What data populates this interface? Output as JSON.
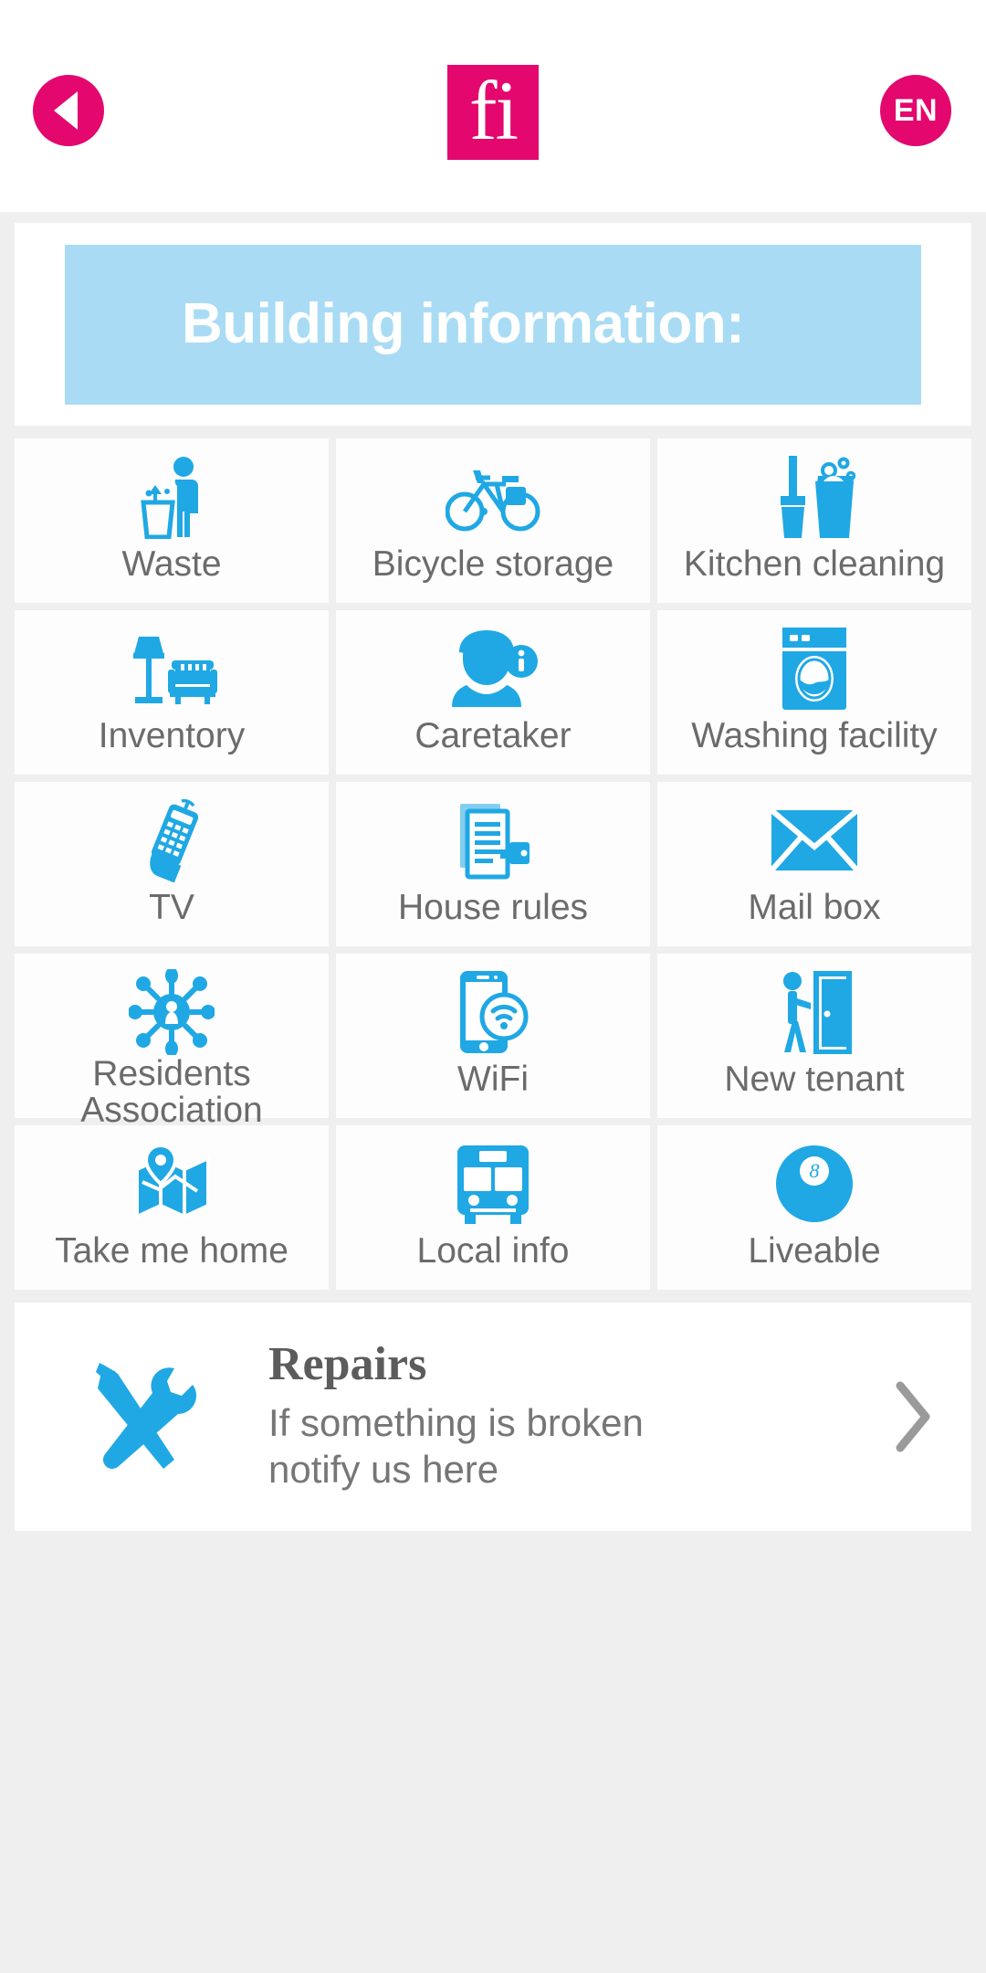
{
  "header": {
    "back_label": "back-arrow",
    "logo_text": "fi",
    "language": "EN"
  },
  "title": {
    "text": "Building information:"
  },
  "grid": {
    "tiles": [
      {
        "label": "Waste",
        "icon": "waste-icon"
      },
      {
        "label": "Bicycle storage",
        "icon": "bicycle-icon"
      },
      {
        "label": "Kitchen cleaning",
        "icon": "cleaning-bucket-icon"
      },
      {
        "label": "Inventory",
        "icon": "lamp-sofa-icon"
      },
      {
        "label": "Caretaker",
        "icon": "person-info-icon"
      },
      {
        "label": "Washing facility",
        "icon": "washing-machine-icon"
      },
      {
        "label": "TV",
        "icon": "remote-control-icon"
      },
      {
        "label": "House rules",
        "icon": "document-stamp-icon"
      },
      {
        "label": "Mail box",
        "icon": "envelope-icon"
      },
      {
        "label": "Residents Association",
        "icon": "network-hub-icon"
      },
      {
        "label": "WiFi",
        "icon": "phone-wifi-icon"
      },
      {
        "label": "New tenant",
        "icon": "person-door-icon"
      },
      {
        "label": "Take me home",
        "icon": "map-pin-icon"
      },
      {
        "label": "Local info",
        "icon": "bus-icon"
      },
      {
        "label": "Liveable",
        "icon": "eight-ball-icon"
      }
    ]
  },
  "repairs": {
    "title": "Repairs",
    "description": "If something is broken",
    "description_line2": "notify us here",
    "chevron": "chevron-right-icon"
  },
  "colors": {
    "brand_pink": "#e3076e",
    "icon_blue": "#1fa8e4",
    "banner_blue": "#a9dcf4",
    "page_bg": "#efefef",
    "label_gray": "#6b6b6b"
  }
}
